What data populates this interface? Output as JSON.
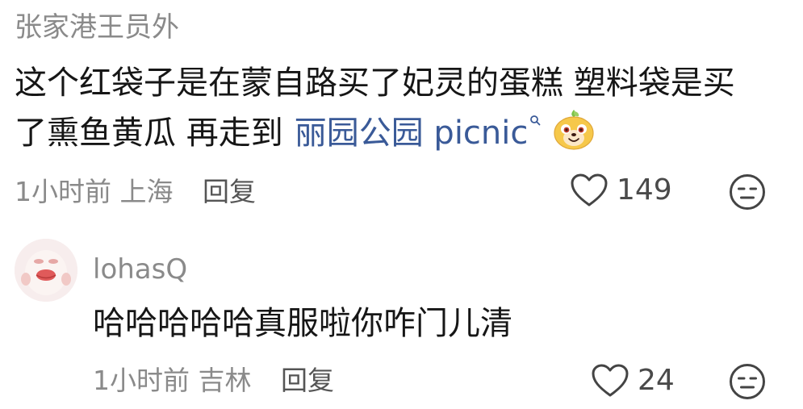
{
  "comments": [
    {
      "username": "张家港王员外",
      "text_line1": "这个红袋子是在蒙自路买了妃灵的蛋糕 塑料袋是买",
      "text_line2_prefix": "了熏鱼黄瓜 再走到",
      "text_link": "丽园公园 picnic",
      "time": "1小时前",
      "location": "上海",
      "reply_label": "回复",
      "likes": "149",
      "emoji": "smiling-dog-emoji"
    },
    {
      "username": "lohasQ",
      "text": "哈哈哈哈哈真服啦你咋门儿清",
      "time": "1小时前",
      "location": "吉林",
      "reply_label": "回复",
      "likes": "24"
    }
  ],
  "icons": {
    "like": "heart-outline-icon",
    "dislike": "meh-face-icon",
    "link_suffix": "search-icon"
  },
  "colors": {
    "link": "#3a5a98",
    "muted": "#8a8a8a",
    "text": "#161616"
  }
}
